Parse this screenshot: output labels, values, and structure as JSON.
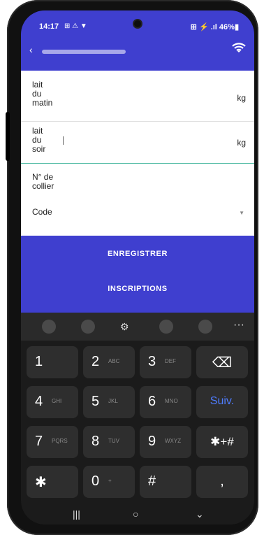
{
  "status": {
    "time": "14:17",
    "left_icons": "⊞ ⚠ ▼",
    "right": "⊞ ⚡ .ıl 46%▮"
  },
  "appbar": {
    "back_icon": "‹",
    "wifi_icon": "wifi-icon"
  },
  "form": {
    "lait_matin_label": "lait\ndu\nmatin",
    "lait_matin_unit": "kg",
    "lait_soir_label": "lait\ndu\nsoir",
    "lait_soir_unit": "kg",
    "collier_label": "N° de\ncollier",
    "code_placeholder": "Code"
  },
  "actions": {
    "enregistrer": "ENREGISTRER",
    "inscriptions": "INSCRIPTIONS"
  },
  "keyboard": {
    "toolbar_more": "···",
    "keys": [
      {
        "num": "1",
        "sub": ""
      },
      {
        "num": "2",
        "sub": "ABC"
      },
      {
        "num": "3",
        "sub": "DEF"
      },
      {
        "num": "⌫",
        "sub": ""
      },
      {
        "num": "4",
        "sub": "GHI"
      },
      {
        "num": "5",
        "sub": "JKL"
      },
      {
        "num": "6",
        "sub": "MNO"
      },
      {
        "num": "Suiv.",
        "sub": ""
      },
      {
        "num": "7",
        "sub": "PQRS"
      },
      {
        "num": "8",
        "sub": "TUV"
      },
      {
        "num": "9",
        "sub": "WXYZ"
      },
      {
        "num": "✱+#",
        "sub": ""
      },
      {
        "num": "✱",
        "sub": ""
      },
      {
        "num": "0",
        "sub": "+"
      },
      {
        "num": "#",
        "sub": ""
      },
      {
        "num": ",",
        "sub": ""
      }
    ]
  },
  "navbar": {
    "recents": "|||",
    "home": "○",
    "back": "⌄"
  },
  "colors": {
    "accent": "#3f3fcf",
    "divider_active": "#3fb49b"
  }
}
